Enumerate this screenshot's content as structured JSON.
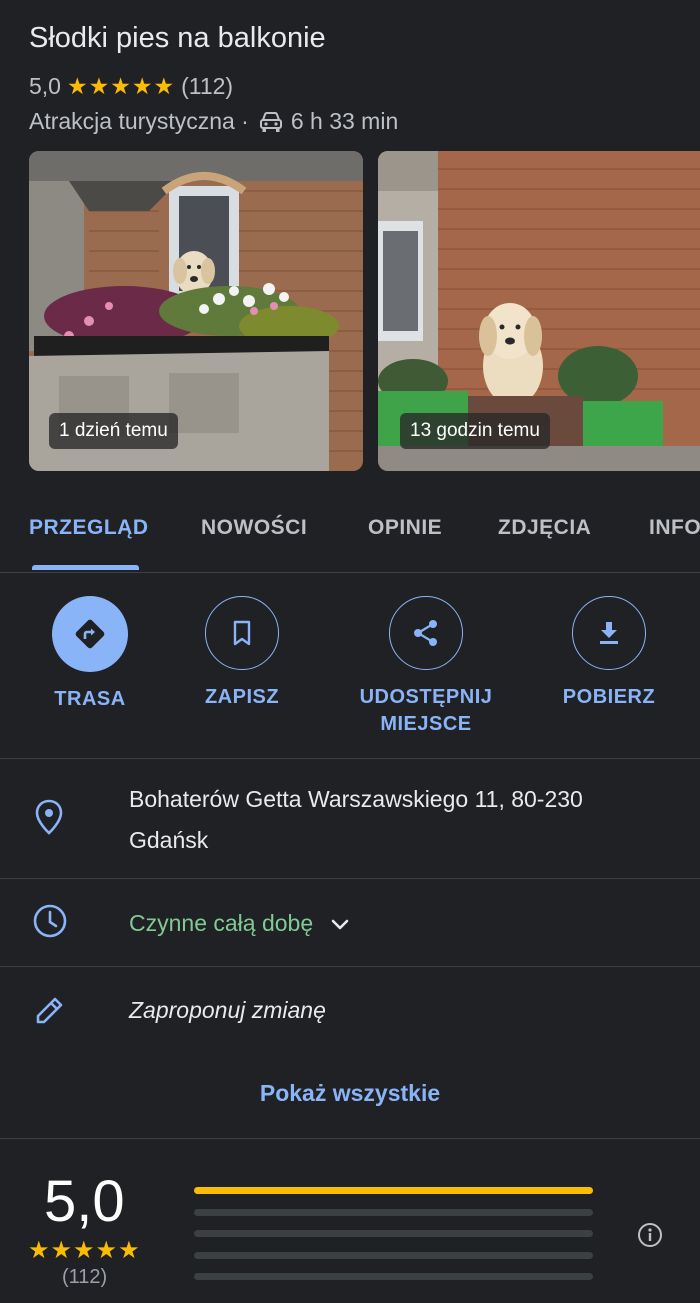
{
  "header": {
    "title": "Słodki pies na balkonie",
    "rating": "5,0",
    "stars": "★★★★★",
    "review_count": "(112)",
    "category": "Atrakcja turystyczna ·",
    "drive_time": "6 h 33 min"
  },
  "photos": [
    {
      "badge": "1 dzień temu"
    },
    {
      "badge": "13 godzin temu"
    }
  ],
  "tabs": [
    {
      "label": "PRZEGLĄD",
      "active": true
    },
    {
      "label": "NOWOŚCI"
    },
    {
      "label": "OPINIE"
    },
    {
      "label": "ZDJĘCIA"
    },
    {
      "label": "INFO"
    }
  ],
  "actions": {
    "route": "TRASA",
    "save": "ZAPISZ",
    "share_line1": "UDOSTĘPNIJ",
    "share_line2": "MIEJSCE",
    "download": "POBIERZ"
  },
  "info": {
    "address_line1": "Bohaterów Getta Warszawskiego 11, 80-230",
    "address_line2": "Gdańsk",
    "hours": "Czynne całą dobę",
    "suggest_edit": "Zaproponuj zmianę",
    "show_all": "Pokaż wszystkie"
  },
  "rating_summary": {
    "value": "5,0",
    "stars": "★★★★★",
    "count": "(112)",
    "distribution": [
      1.0,
      0,
      0,
      0,
      0
    ]
  },
  "colors": {
    "accent": "#8ab4f8",
    "star": "#fbbc04",
    "open": "#81c995",
    "background": "#202124"
  }
}
